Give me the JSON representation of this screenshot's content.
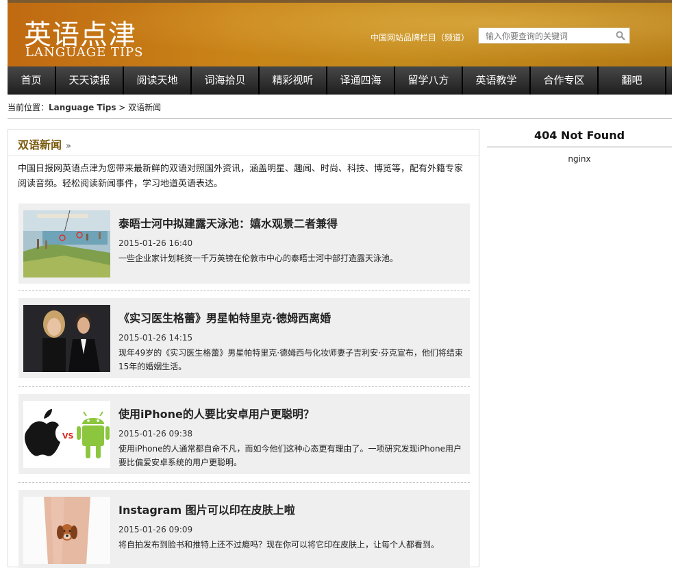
{
  "header": {
    "logo_cn": "英语点津",
    "logo_en": "LANGUAGE TIPS",
    "brand_note": "中国网站品牌栏目（频道）",
    "search_placeholder": "输入你要查询的关键词",
    "search_icon": "search-icon"
  },
  "nav": [
    {
      "label": "首页"
    },
    {
      "label": "天天读报"
    },
    {
      "label": "阅读天地"
    },
    {
      "label": "词海拾贝"
    },
    {
      "label": "精彩视听"
    },
    {
      "label": "译通四海"
    },
    {
      "label": "留学八方"
    },
    {
      "label": "英语教学"
    },
    {
      "label": "合作专区"
    },
    {
      "label": "翻吧"
    }
  ],
  "breadcrumb": {
    "prefix": "当前位置：",
    "home": "Language Tips",
    "sep": " > ",
    "current": "双语新闻"
  },
  "main": {
    "title": "双语新闻",
    "arrow": "»",
    "intro": "中国日报网英语点津为您带来最新鲜的双语对照国外资讯，涵盖明星、趣闻、时尚、科技、博览等，配有外籍专家阅读音频。轻松阅读新闻事件，学习地道英语表达。"
  },
  "articles": [
    {
      "title": "泰晤士河中拟建露天泳池：嬉水观景二者兼得",
      "date": "2015-01-26 16:40",
      "desc": "一些企业家计划耗资一千万英镑在伦敦市中心的泰晤士河中部打造露天泳池。"
    },
    {
      "title": "《实习医生格蕾》男星帕特里克·德姆西离婚",
      "date": "2015-01-26 14:15",
      "desc": "现年49岁的《实习医生格蕾》男星帕特里克·德姆西与化妆师妻子吉利安·芬克宣布，他们将结束15年的婚姻生活。"
    },
    {
      "title": "使用iPhone的人要比安卓用户更聪明？",
      "date": "2015-01-26 09:38",
      "desc": "使用iPhone的人通常都自命不凡，而如今他们这种心态更有理由了。一项研究发现iPhone用户要比偏爱安卓系统的用户更聪明。",
      "thumb_vs": "VS"
    },
    {
      "title": "Instagram 图片可以印在皮肤上啦",
      "date": "2015-01-26 09:09",
      "desc": "将自拍发布到脸书和推特上还不过瘾吗？现在你可以将它印在皮肤上，让每个人都看到。"
    }
  ],
  "sidebar": {
    "title": "404 Not Found",
    "sub": "nginx"
  }
}
